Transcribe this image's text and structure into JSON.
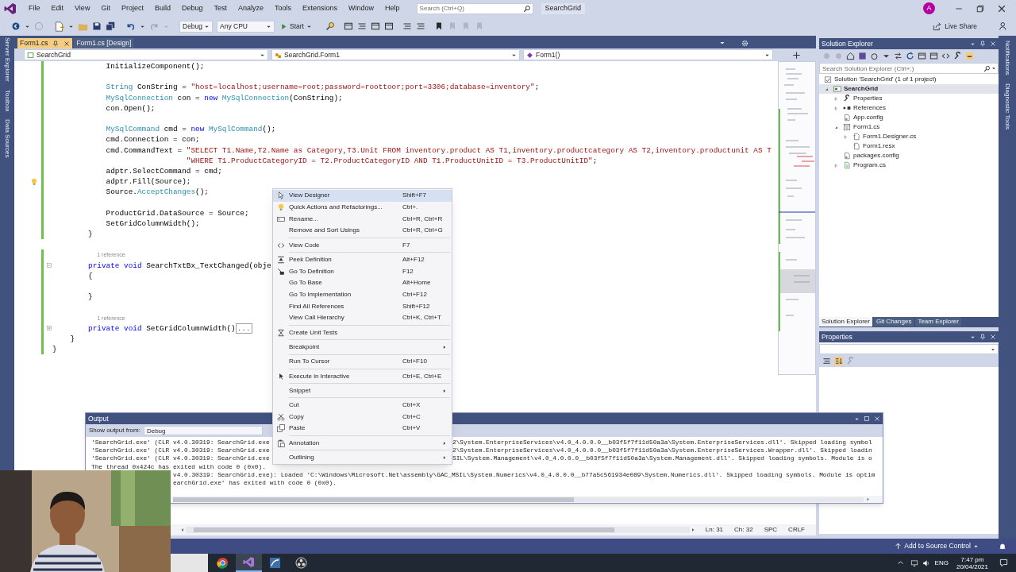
{
  "menu_bar": {
    "items": [
      "File",
      "Edit",
      "View",
      "Git",
      "Project",
      "Build",
      "Debug",
      "Test",
      "Analyze",
      "Tools",
      "Extensions",
      "Window",
      "Help"
    ],
    "search": {
      "placeholder": "Search (Ctrl+Q)"
    },
    "solution_name": "SearchGrid",
    "avatar": "A"
  },
  "toolbar": {
    "configuration": "Debug",
    "platform": "Any CPU",
    "start": "Start",
    "live_share": "Live Share"
  },
  "left_strip": [
    "Server Explorer",
    "Toolbox",
    "Data Sources"
  ],
  "right_strip": [
    "Notifications",
    "Diagnostic Tools"
  ],
  "editor": {
    "tabs": [
      {
        "label": "Form1.cs",
        "selected": true
      },
      {
        "label": "Form1.cs [Design]",
        "selected": false
      }
    ],
    "nav": [
      "SearchGrid",
      "SearchGrid.Form1",
      "Form1()"
    ],
    "lines": [
      {
        "changed": true,
        "tokens": [
          {
            "kind": "plain",
            "text": "            InitializeComponent();"
          }
        ]
      },
      {
        "changed": true
      },
      {
        "changed": true,
        "tokens": [
          {
            "kind": "type",
            "text": "            String"
          },
          {
            "kind": "plain",
            "text": " ConString = "
          },
          {
            "kind": "string",
            "text": "\"host=localhost;username=root;password=roottoor;port=3306;database=inventory\""
          },
          {
            "kind": "plain",
            "text": ";"
          }
        ]
      },
      {
        "changed": true,
        "tokens": [
          {
            "kind": "type",
            "text": "            MySqlConnection"
          },
          {
            "kind": "plain",
            "text": " con = "
          },
          {
            "kind": "keyword",
            "text": "new"
          },
          {
            "kind": "type",
            "text": " MySqlConnection"
          },
          {
            "kind": "plain",
            "text": "(ConString);"
          }
        ]
      },
      {
        "changed": true,
        "tokens": [
          {
            "kind": "plain",
            "text": "            con.Open();"
          }
        ]
      },
      {
        "changed": true
      },
      {
        "changed": true,
        "tokens": [
          {
            "kind": "type",
            "text": "            MySqlCommand"
          },
          {
            "kind": "plain",
            "text": " cmd = "
          },
          {
            "kind": "keyword",
            "text": "new"
          },
          {
            "kind": "type",
            "text": " MySqlCommand"
          },
          {
            "kind": "plain",
            "text": "();"
          }
        ]
      },
      {
        "changed": true,
        "tokens": [
          {
            "kind": "plain",
            "text": "            cmd.Connection = con;"
          }
        ]
      },
      {
        "changed": true,
        "tokens": [
          {
            "kind": "plain",
            "text": "            cmd.CommandText = "
          },
          {
            "kind": "string",
            "text": "\"SELECT T1.Name,T2.Name as Category,T3.Unit FROM inventory.product AS T1,inventory.productcategory AS T2,inventory.productunit AS T"
          }
        ]
      },
      {
        "changed": true,
        "tokens": [
          {
            "kind": "string",
            "text": "                              \"WHERE T1.ProductCategoryID = T2.ProductCategoryID AND T1.ProductUnitID = T3.ProductUnitID\""
          },
          {
            "kind": "plain",
            "text": ";"
          }
        ]
      },
      {
        "changed": true,
        "tokens": [
          {
            "kind": "plain",
            "text": "            adptr.SelectCommand = cmd;"
          }
        ]
      },
      {
        "changed": true,
        "margin": {
          "kind": "lightbulb"
        },
        "tokens": [
          {
            "kind": "plain",
            "text": "            adptr.Fill(Source);"
          }
        ]
      },
      {
        "changed": true,
        "tokens": [
          {
            "kind": "plain",
            "text": "            Source."
          },
          {
            "kind": "type",
            "text": "AcceptChanges"
          },
          {
            "kind": "plain",
            "text": "();"
          }
        ]
      },
      {
        "changed": true
      },
      {
        "changed": true,
        "tokens": [
          {
            "kind": "plain",
            "text": "            ProductGrid.DataSource = Source;"
          }
        ]
      },
      {
        "changed": true,
        "tokens": [
          {
            "kind": "plain",
            "text": "            SetGridColumnWidth();"
          }
        ]
      },
      {
        "changed": true,
        "tokens": [
          {
            "kind": "plain",
            "text": "        }"
          }
        ]
      },
      {
        "changed": false
      },
      {
        "changed": true,
        "tokens": [
          {
            "kind": "lens",
            "text": "          1 reference"
          }
        ]
      },
      {
        "changed": true,
        "margin": {
          "kind": "collapse"
        },
        "tokens": [
          {
            "kind": "keyword",
            "text": "        private"
          },
          {
            "kind": "keyword",
            "text": " void"
          },
          {
            "kind": "plain",
            "text": " SearchTxtBx_TextChanged(obje"
          }
        ]
      },
      {
        "changed": true,
        "tokens": [
          {
            "kind": "plain",
            "text": "        {"
          }
        ]
      },
      {
        "changed": true
      },
      {
        "changed": true,
        "tokens": [
          {
            "kind": "plain",
            "text": "        }"
          }
        ]
      },
      {
        "changed": true
      },
      {
        "changed": true,
        "tokens": [
          {
            "kind": "lens",
            "text": "          1 reference"
          }
        ]
      },
      {
        "changed": true,
        "margin": {
          "kind": "expand"
        },
        "tokens": [
          {
            "kind": "keyword",
            "text": "        private"
          },
          {
            "kind": "keyword",
            "text": " void"
          },
          {
            "kind": "plain",
            "text": " SetGridColumnWidth()"
          },
          {
            "kind": "fold",
            "text": "..."
          }
        ]
      },
      {
        "changed": true,
        "tokens": [
          {
            "kind": "plain",
            "text": "    }"
          }
        ]
      },
      {
        "changed": true,
        "tokens": [
          {
            "kind": "plain",
            "text": "}"
          }
        ]
      }
    ],
    "status": [
      "Ln: 31",
      "Ch: 32",
      "SPC",
      "CRLF"
    ]
  },
  "context_menu": {
    "groups": [
      [
        {
          "label": "View Designer",
          "shortcut": "Shift+F7",
          "submenu": false,
          "selected": true
        },
        {
          "label": "Quick Actions and Refactorings...",
          "shortcut": "Ctrl+.",
          "submenu": false,
          "selected": false
        },
        {
          "label": "Rename...",
          "shortcut": "Ctrl+R, Ctrl+R",
          "submenu": false,
          "selected": false
        },
        {
          "label": "Remove and Sort Usings",
          "shortcut": "Ctrl+R, Ctrl+G",
          "submenu": false,
          "selected": false
        }
      ],
      [
        {
          "label": "View Code",
          "shortcut": "F7",
          "submenu": false,
          "selected": false
        }
      ],
      [
        {
          "label": "Peek Definition",
          "shortcut": "Alt+F12",
          "submenu": false,
          "selected": false
        },
        {
          "label": "Go To Definition",
          "shortcut": "F12",
          "submenu": false,
          "selected": false
        },
        {
          "label": "Go To Base",
          "shortcut": "Alt+Home",
          "submenu": false,
          "selected": false
        },
        {
          "label": "Go To Implementation",
          "shortcut": "Ctrl+F12",
          "submenu": false,
          "selected": false
        },
        {
          "label": "Find All References",
          "shortcut": "Shift+F12",
          "submenu": false,
          "selected": false
        },
        {
          "label": "View Call Hierarchy",
          "shortcut": "Ctrl+K, Ctrl+T",
          "submenu": false,
          "selected": false
        }
      ],
      [
        {
          "label": "Create Unit Tests",
          "submenu": false,
          "selected": false
        }
      ],
      [
        {
          "label": "Breakpoint",
          "submenu": true,
          "selected": false
        }
      ],
      [
        {
          "label": "Run To Cursor",
          "shortcut": "Ctrl+F10",
          "submenu": false,
          "selected": false
        }
      ],
      [
        {
          "label": "Execute in Interactive",
          "shortcut": "Ctrl+E, Ctrl+E",
          "submenu": false,
          "selected": false
        }
      ],
      [
        {
          "label": "Snippet",
          "submenu": true,
          "selected": false
        }
      ],
      [
        {
          "label": "Cut",
          "shortcut": "Ctrl+X",
          "submenu": false,
          "selected": false
        },
        {
          "label": "Copy",
          "shortcut": "Ctrl+C",
          "submenu": false,
          "selected": false
        },
        {
          "label": "Paste",
          "shortcut": "Ctrl+V",
          "submenu": false,
          "selected": false
        }
      ],
      [
        {
          "label": "Annotation",
          "submenu": true,
          "selected": false
        }
      ],
      [
        {
          "label": "Outlining",
          "submenu": true,
          "selected": false
        }
      ]
    ]
  },
  "output": {
    "title": "Output",
    "source_label": "Show output from:",
    "source": "Debug",
    "lines": [
      {
        "kind": "split",
        "left": "'SearchGrid.exe' (CLR v4.0.30319: SearchGrid.exe",
        "right": "2\\System.EnterpriseServices\\v4.0_4.0.0.0__b03f5f7f11d50a3a\\System.EnterpriseServices.dll'. Skipped loading symbol"
      },
      {
        "kind": "split",
        "left": "'SearchGrid.exe' (CLR v4.0.30319: SearchGrid.exe",
        "right": "2\\System.EnterpriseServices\\v4.0_4.0.0.0__b03f5f7f11d50a3a\\System.EnterpriseServices.Wrapper.dll'. Skipped loadin"
      },
      {
        "kind": "split",
        "left": "'SearchGrid.exe' (CLR v4.0.30319: SearchGrid.exe",
        "right": "SIL\\System.Management\\v4.0_4.0.0.0__b03f5f7f11d50a3a\\System.Management.dll'. Skipped loading symbols. Module is o"
      },
      {
        "kind": "full",
        "text": "The thread 0x424c has exited with code 0 (0x0)."
      },
      {
        "kind": "covered_start",
        "text": "v4.0.30319: SearchGrid.exe): Loaded 'C:\\Windows\\Microsoft.Net\\assembly\\GAC_MSIL\\System.Numerics\\v4.0_4.0.0.0__b77a5c561934e089\\System.Numerics.dll'. Skipped loading symbols. Module is optim"
      },
      {
        "kind": "covered_start",
        "text": "earchGrid.exe' has exited with code 0 (0x0)."
      }
    ]
  },
  "solution_explorer": {
    "title": "Solution Explorer",
    "search": {
      "placeholder": "Search Solution Explorer (Ctrl+;)"
    },
    "tree": [
      {
        "label": "Solution 'SearchGrid' (1 of 1 project)",
        "kind": "solution",
        "expandable": false,
        "selected": false,
        "startup": false,
        "children": [
          {
            "label": "SearchGrid",
            "kind": "project",
            "expandable": true,
            "expanded": true,
            "selected": true,
            "startup": true,
            "children": [
              {
                "label": "Properties",
                "kind": "properties",
                "expandable": true,
                "expanded": false,
                "selected": false,
                "startup": false
              },
              {
                "label": "References",
                "kind": "references",
                "expandable": true,
                "expanded": false,
                "selected": false,
                "startup": false
              },
              {
                "label": "App.config",
                "kind": "config",
                "expandable": false,
                "selected": false,
                "startup": false
              },
              {
                "label": "Form1.cs",
                "kind": "form",
                "expandable": true,
                "expanded": true,
                "selected": false,
                "startup": false,
                "children": [
                  {
                    "label": "Form1.Designer.cs",
                    "kind": "file",
                    "expandable": true,
                    "expanded": false,
                    "selected": false,
                    "startup": false
                  },
                  {
                    "label": "Form1.resx",
                    "kind": "file",
                    "expandable": false,
                    "selected": false,
                    "startup": false
                  }
                ]
              },
              {
                "label": "packages.config",
                "kind": "config",
                "expandable": false,
                "selected": false,
                "startup": false
              },
              {
                "label": "Program.cs",
                "kind": "csharp",
                "expandable": true,
                "expanded": false,
                "selected": false,
                "startup": false
              }
            ]
          }
        ]
      }
    ],
    "tabs": [
      {
        "label": "Solution Explorer",
        "selected": true
      },
      {
        "label": "Git Changes",
        "selected": false
      },
      {
        "label": "Team Explorer",
        "selected": false
      }
    ]
  },
  "properties": {
    "title": "Properties"
  },
  "status_bar": {
    "source_control": "Add to Source Control"
  },
  "taskbar": {
    "apps": [
      {
        "kind": "browser",
        "selected": false
      },
      {
        "kind": "ide",
        "selected": true
      },
      {
        "kind": "database",
        "selected": false
      },
      {
        "kind": "recorder",
        "selected": false
      }
    ],
    "language": "ENG",
    "time": "7:47 pm",
    "date": "20/04/2021"
  },
  "webcam": {
    "kind": "picture"
  }
}
